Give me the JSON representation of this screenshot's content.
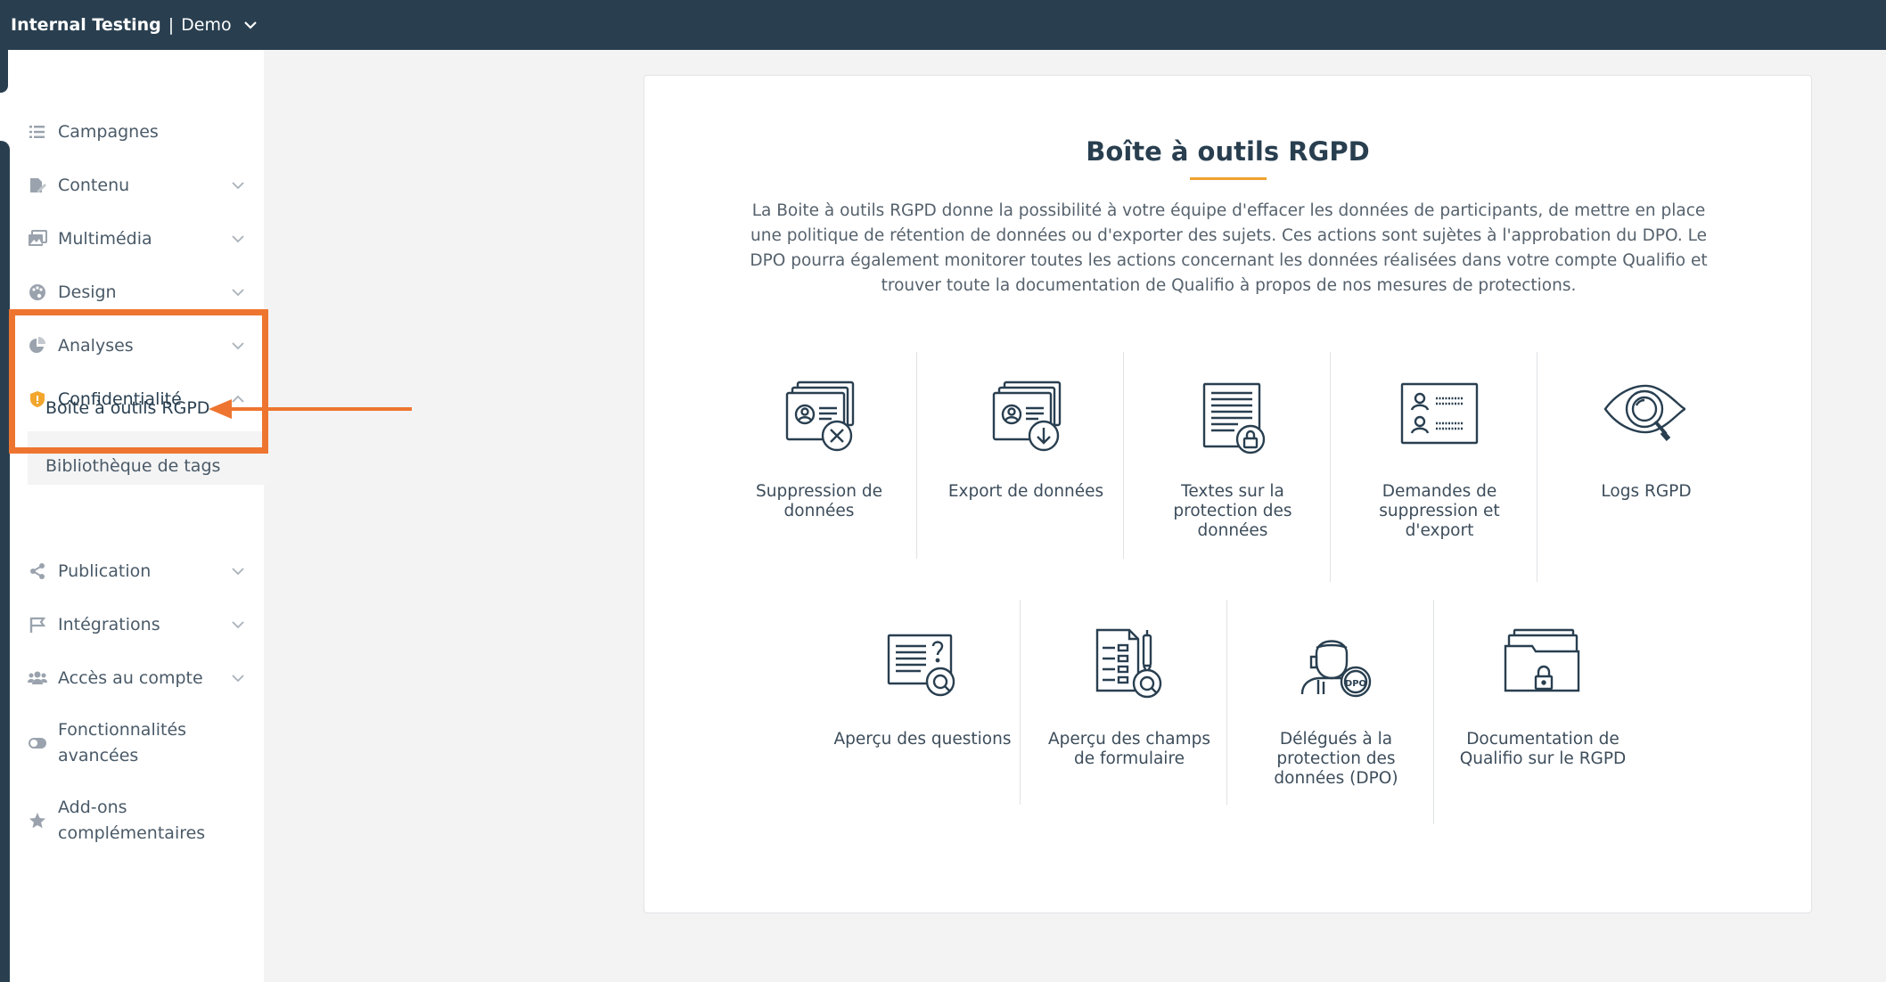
{
  "topbar": {
    "org": "Internal Testing",
    "separator": "|",
    "env": "Demo"
  },
  "sidebar": {
    "items": [
      {
        "label": "Campagnes"
      },
      {
        "label": "Contenu"
      },
      {
        "label": "Multimédia"
      },
      {
        "label": "Design"
      },
      {
        "label": "Analyses"
      },
      {
        "label": "Confidentialité"
      },
      {
        "label": "Publication"
      },
      {
        "label": "Intégrations"
      },
      {
        "label": "Accès au compte"
      },
      {
        "label_line1": "Fonctionnalités",
        "label_line2": "avancées"
      },
      {
        "label_line1": "Add-ons",
        "label_line2": "complémentaires"
      }
    ],
    "sub_items": [
      {
        "label": "Boîte à outils RGPD"
      },
      {
        "label": "Bibliothèque de tags"
      }
    ]
  },
  "main": {
    "title": "Boîte à outils RGPD",
    "description": "La Boite à outils RGPD donne la possibilité à votre équipe d'effacer les données de participants, de mettre en place une politique de rétention de données ou d'exporter des sujets. Ces actions sont sujètes à l'approbation du DPO. Le DPO pourra également monitorer toutes les actions concernant les données réalisées dans votre compte Qualifio et trouver toute la documentation de Qualifio à propos de nos mesures de protections.",
    "tools": [
      {
        "l1": "Suppression de",
        "l2": "données",
        "l3": ""
      },
      {
        "l1": "Export de données",
        "l2": "",
        "l3": ""
      },
      {
        "l1": "Textes sur la",
        "l2": "protection des",
        "l3": "données"
      },
      {
        "l1": "Demandes de",
        "l2": "suppression et",
        "l3": "d'export"
      },
      {
        "l1": "Logs RGPD",
        "l2": "",
        "l3": ""
      },
      {
        "l1": "Aperçu des questions",
        "l2": "",
        "l3": ""
      },
      {
        "l1": "Aperçu des champs",
        "l2": "de formulaire",
        "l3": ""
      },
      {
        "l1": "Délégués à la",
        "l2": "protection des",
        "l3": "données (DPO)"
      },
      {
        "l1": "Documentation de",
        "l2": "Qualifio sur le RGPD",
        "l3": ""
      }
    ],
    "dpo_badge": "DPO"
  },
  "colors": {
    "topbar": "#293f50",
    "accent": "#ee7530",
    "underline": "#f0a12c",
    "shield": "#f2a62e"
  }
}
